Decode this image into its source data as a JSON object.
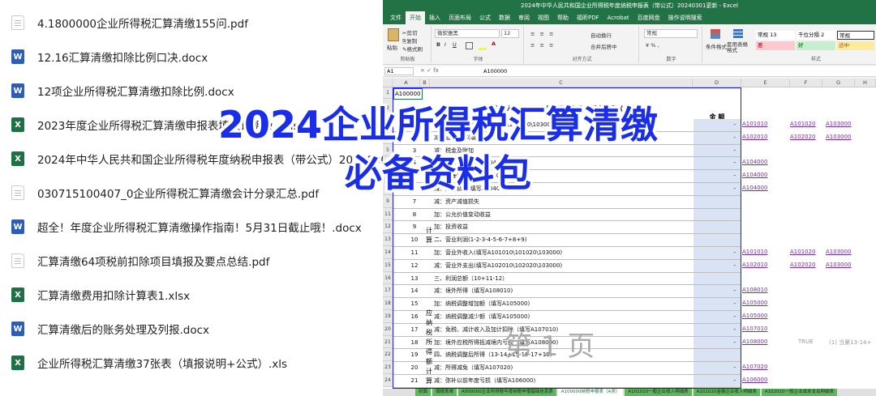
{
  "files": [
    {
      "name": "4.1800000企业所得税汇算清缴155问.pdf",
      "type": "pdf"
    },
    {
      "name": "12.16汇算清缴扣除比例口决.docx",
      "type": "docx"
    },
    {
      "name": "12项企业所得税汇算清缴扣除比例.docx",
      "type": "docx"
    },
    {
      "name": "2023年度企业所得税汇算清缴申报表填报说明及...xls",
      "type": "xls"
    },
    {
      "name": "2024年中华人民共和国企业所得税年度纳税申报表（带公式）2024030",
      "type": "xls"
    },
    {
      "name": "030715100407_0企业所得税汇算清缴会计分录汇总.pdf",
      "type": "pdf"
    },
    {
      "name": "超全！年度企业所得税汇算清缴操作指南！5月31日截止哦！.docx",
      "type": "docx"
    },
    {
      "name": "汇算清缴64项税前扣除项目填报及要点总结.pdf",
      "type": "pdf"
    },
    {
      "name": "汇算清缴费用扣除计算表1.xlsx",
      "type": "xls"
    },
    {
      "name": "汇算清缴后的账务处理及列报.docx",
      "type": "docx"
    },
    {
      "name": "企业所得税汇算清缴37张表（填报说明+公式）.xls",
      "type": "xls"
    }
  ],
  "icon_labels": {
    "pdf": "",
    "docx": "W",
    "xls": "X"
  },
  "overlay": {
    "line1": "2024企业所得税汇算清缴",
    "line2": "必备资料包"
  },
  "excel": {
    "title": "2024年中华人民共和国企业所得税年度纳税申报表（带公式）20240301更新 - Excel",
    "menu": [
      "文件",
      "开始",
      "插入",
      "页面布局",
      "公式",
      "数据",
      "审阅",
      "视图",
      "帮助",
      "福昕PDF",
      "Acrobat",
      "百度网盘",
      "操作说明搜索"
    ],
    "ribbon": {
      "clipboard": "剪贴板",
      "paste": "粘贴",
      "cut": "剪切",
      "copy": "复制",
      "format_painter": "格式刷",
      "font_group": "字体",
      "font_name": "微软雅黑",
      "font_size": "12",
      "align_group": "对齐方式",
      "wrap": "自动换行",
      "merge": "合并后居中",
      "number_group": "数字",
      "number_format": "常规",
      "cond_format": "条件格式",
      "table_format": "套用表格格式",
      "styles_group": "样式",
      "style1": "常规 13",
      "style2": "千位分隔 2",
      "style3": "常规",
      "style_bad": "差",
      "style_good": "好",
      "style_neutral": "适中"
    },
    "name_box": "A1",
    "formula": "A100000",
    "columns": [
      "A",
      "B",
      "C",
      "D",
      "E",
      "F",
      "G",
      "H"
    ],
    "cell_a1": "A100000",
    "sheet_title": "中华人民共和国企业所得税年度纳税申报表（A类）",
    "amount_header": "金 额",
    "rows": [
      {
        "r": "3",
        "num": "1",
        "item": "一、营业收入(填写A101010\\101020\\103000)",
        "val": "-"
      },
      {
        "r": "4",
        "num": "2",
        "item": "减：营业成本(填写A102010\\102020\\103000)",
        "val": "-"
      },
      {
        "r": "5",
        "num": "3",
        "item": "减：税金及附加",
        "val": "-"
      },
      {
        "r": "6",
        "num": "4",
        "item": "减：销售费用(填写A104000)",
        "val": "-"
      },
      {
        "r": "7",
        "num": "5",
        "item": "减：管理费用(填写A104000)",
        "val": "-"
      },
      {
        "r": "8",
        "num": "6",
        "item": "减：财务费用(填写A104000)",
        "val": "-"
      },
      {
        "r": "9",
        "num": "7",
        "item": "减：资产减值损失",
        "val": ""
      },
      {
        "r": "11",
        "num": "8",
        "item": "加：公允价值变动收益",
        "val": ""
      },
      {
        "r": "12",
        "num": "9",
        "item": "加：投资收益",
        "val": ""
      },
      {
        "r": "13",
        "num": "10",
        "item": "二、营业利润(1-2-3-4-5-6-7+8+9)",
        "val": ""
      },
      {
        "r": "14",
        "num": "11",
        "item": "加：营业外收入(填写A101010\\101020\\103000)",
        "val": "-"
      },
      {
        "r": "15",
        "num": "12",
        "item": "减：营业外支出(填写A102010\\102020\\103000)",
        "val": "-"
      },
      {
        "r": "16",
        "num": "13",
        "item": "三、利润总额（10+11-12）",
        "val": ""
      },
      {
        "r": "17",
        "num": "14",
        "item": "减：境外所得（填写A108010)",
        "val": "-"
      },
      {
        "r": "18",
        "num": "15",
        "item": "加：纳税调整增加额（填写A105000)",
        "val": "-"
      },
      {
        "r": "19",
        "num": "16",
        "item": "减：纳税调整减少额（填写A105000)",
        "val": "-"
      },
      {
        "r": "20",
        "num": "17",
        "item": "减：免税、减计收入及加计扣除（填写A107010)",
        "val": "-"
      },
      {
        "r": "21",
        "num": "18",
        "item": "加：境外应税所得抵减境内亏损（填写A108000)",
        "val": "-"
      },
      {
        "r": "22",
        "num": "19",
        "item": "四、纳税调整后所得（13-14+15-16-17+18)",
        "val": ""
      },
      {
        "r": "23",
        "num": "20",
        "item": "减：所得减免（填写A107020)",
        "val": "-"
      },
      {
        "r": "24",
        "num": "21",
        "item": "减：弥补以前年度亏损（填写A106000)",
        "val": "-"
      }
    ],
    "side_links": [
      {
        "row": 0,
        "e": "A101010",
        "f": "A101020",
        "g": "A103000"
      },
      {
        "row": 1,
        "e": "A102010",
        "f": "A102020",
        "g": "A103000"
      },
      {
        "row": 3,
        "e": "A104000",
        "f": "",
        "g": ""
      },
      {
        "row": 4,
        "e": "A104000",
        "f": "",
        "g": ""
      },
      {
        "row": 5,
        "e": "A104000",
        "f": "",
        "g": ""
      },
      {
        "row": 10,
        "e": "A101010",
        "f": "A101020",
        "g": "A103000"
      },
      {
        "row": 11,
        "e": "A102010",
        "f": "A102020",
        "g": "A103000"
      },
      {
        "row": 13,
        "e": "A108010",
        "f": "",
        "g": ""
      },
      {
        "row": 14,
        "e": "A105000",
        "f": "",
        "g": ""
      },
      {
        "row": 15,
        "e": "A105000",
        "f": "",
        "g": ""
      },
      {
        "row": 16,
        "e": "A107010",
        "f": "",
        "g": ""
      },
      {
        "row": 17,
        "e": "A108000",
        "f": "",
        "g": ""
      },
      {
        "row": 19,
        "e": "A107020",
        "f": "",
        "g": ""
      },
      {
        "row": 20,
        "e": "A106000",
        "f": "",
        "g": ""
      }
    ],
    "side_note": {
      "bool": "TRUE",
      "text": "(1) 当第13-14+"
    },
    "section_labels": {
      "b1": "利",
      "b2": "润",
      "b3": "总",
      "b4": "额",
      "b5": "计",
      "b6": "算",
      "c1": "应",
      "c2": "纳",
      "c3": "税",
      "c4": "所",
      "c5": "得",
      "c6": "额",
      "c7": "计",
      "c8": "算"
    },
    "page_watermark": "第 1 页",
    "sheet_tabs": [
      {
        "label": "封面",
        "active": false
      },
      {
        "label": "填报表单",
        "active": false
      },
      {
        "label": "A000000企业所得税年度纳税申报基础信息表",
        "active": false
      },
      {
        "label": "A100000纳税申报表（A类）",
        "active": true
      },
      {
        "label": "A101010一般企业收入明细表",
        "active": false
      },
      {
        "label": "A101020金融企业收入明细表",
        "active": false
      },
      {
        "label": "A102010一般企业成本支出明细表",
        "active": false
      }
    ]
  }
}
